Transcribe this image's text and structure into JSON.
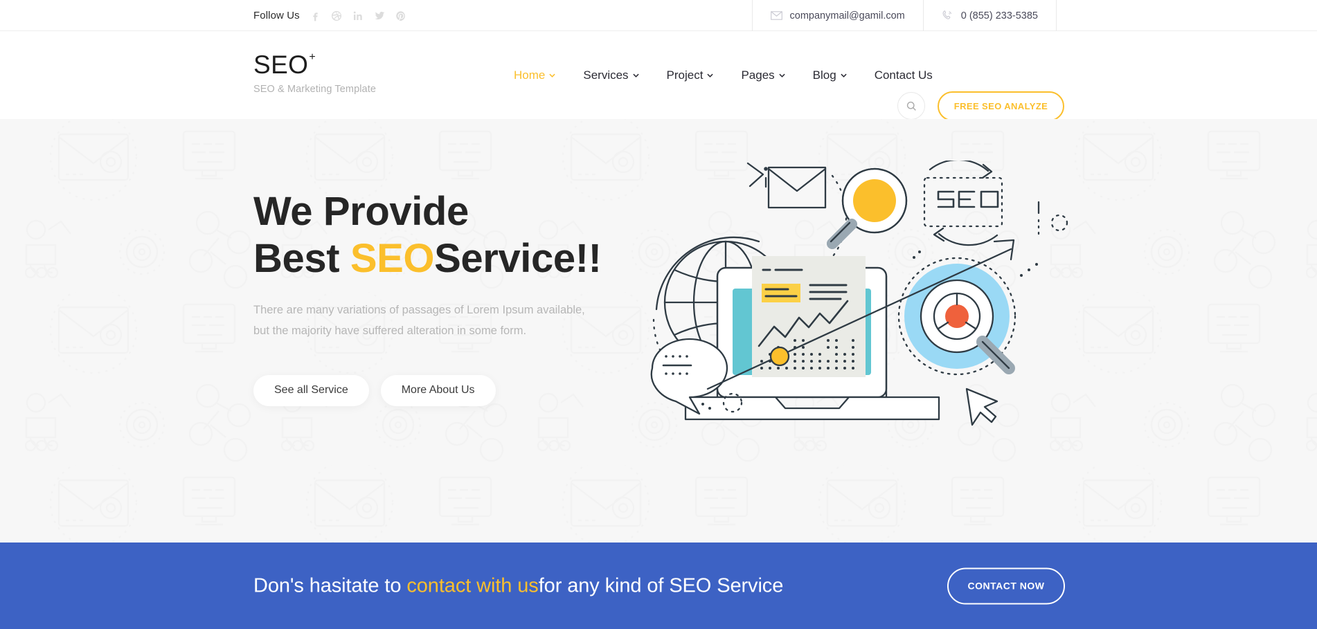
{
  "colors": {
    "accent_yellow": "#fbbf2c",
    "banner_blue": "#3d62c4",
    "hero_bg": "#f7f7f7",
    "text_dark": "#262626",
    "teal": "#62c6d2",
    "orange": "#ef613c",
    "light_blue": "#9ad9f5"
  },
  "topbar": {
    "follow_label": "Follow Us",
    "social": [
      {
        "name": "facebook-icon",
        "label": "Facebook"
      },
      {
        "name": "dribbble-icon",
        "label": "Dribbble"
      },
      {
        "name": "linkedin-icon",
        "label": "LinkedIn"
      },
      {
        "name": "twitter-icon",
        "label": "Twitter"
      },
      {
        "name": "pinterest-icon",
        "label": "Pinterest"
      }
    ],
    "email": "companymail@gamil.com",
    "phone": "0 (855) 233-5385"
  },
  "header": {
    "logo": "SEO",
    "logo_mark": "+",
    "tagline": "SEO & Marketing Template",
    "nav": [
      {
        "label": "Home",
        "has_dropdown": true,
        "active": true
      },
      {
        "label": "Services",
        "has_dropdown": true,
        "active": false
      },
      {
        "label": "Project",
        "has_dropdown": true,
        "active": false
      },
      {
        "label": "Pages",
        "has_dropdown": true,
        "active": false
      },
      {
        "label": "Blog",
        "has_dropdown": true,
        "active": false
      },
      {
        "label": "Contact Us",
        "has_dropdown": false,
        "active": false
      }
    ],
    "search_icon": "search-icon",
    "cta_label": "FREE SEO ANALYZE"
  },
  "hero": {
    "title_line1": "We Provide",
    "title_line2_pre": "Best ",
    "title_line2_highlight": "SEO",
    "title_line2_post": "Service!!",
    "subtitle_line1": "There are many variations of passages of Lorem Ipsum available,",
    "subtitle_line2": "but the majority have suffered alteration in some form.",
    "buttons": [
      {
        "label": "See all Service"
      },
      {
        "label": "More About Us"
      }
    ],
    "illustration": {
      "name": "seo-analytics-illustration",
      "badge_text": "SEO",
      "elements": [
        "globe-icon",
        "envelope-icon",
        "magnifier-yellow-icon",
        "seo-dotted-badge",
        "laptop-chart-icon",
        "target-magnifier-icon",
        "speech-bubble-icon",
        "cursor-arrow-icon",
        "growth-arrow"
      ]
    }
  },
  "cta_band": {
    "text_pre": "Don's hasitate to ",
    "text_highlight": "contact with us",
    "text_post": "for any kind of SEO Service",
    "button_label": "CONTACT NOW"
  }
}
